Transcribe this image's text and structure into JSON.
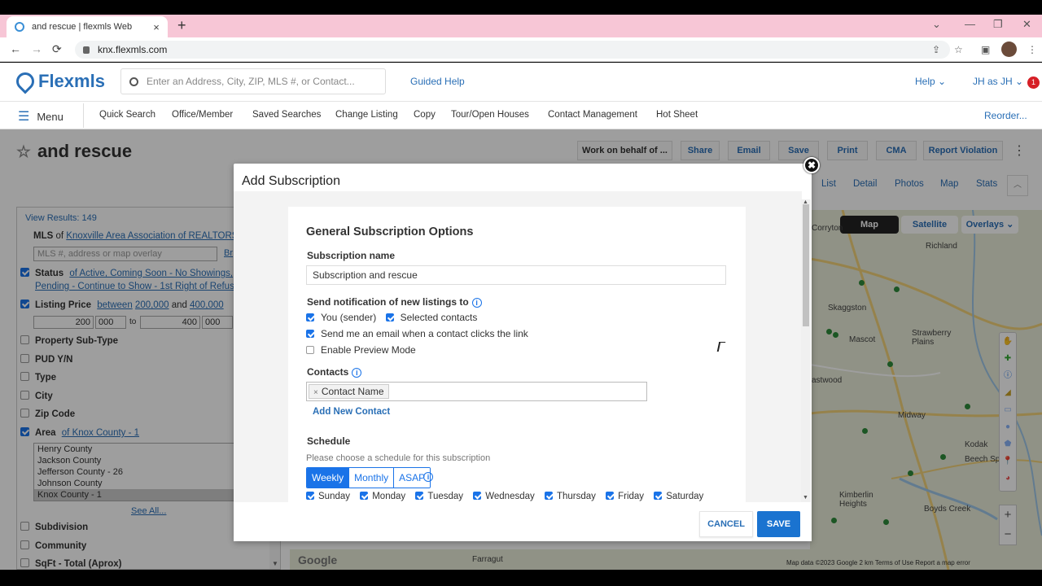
{
  "browser": {
    "tab_title": "and rescue | flexmls Web",
    "tab_close": "×",
    "new_tab": "+",
    "url": "knx.flexmls.com",
    "back": "←",
    "forward": "→",
    "reload": "⟳",
    "minimize": "—",
    "maximize": "❐",
    "close": "✕",
    "tab_menu": "⌄"
  },
  "app_header": {
    "logo_text": "Flexmls",
    "search_placeholder": "Enter an Address, City, ZIP, MLS #, or Contact...",
    "guided_help": "Guided Help",
    "help": "Help ⌄",
    "user": "JH as JH ⌄",
    "notification_count": "1"
  },
  "menu": {
    "label": "Menu",
    "items": [
      "Quick Search",
      "Office/Member",
      "Saved Searches",
      "Change Listing",
      "Copy",
      "Tour/Open Houses",
      "Contact Management",
      "Hot Sheet"
    ],
    "reorder": "Reorder..."
  },
  "page": {
    "title": "and rescue",
    "toolbar": [
      "Work on behalf of ...",
      "Share",
      "Email",
      "Save",
      "Print",
      "CMA",
      "Report Violation"
    ],
    "view_tabs": [
      "List",
      "Detail",
      "Photos",
      "Map",
      "Stats"
    ]
  },
  "filters": {
    "view_results": "View Results: 149",
    "mls_label": "MLS",
    "mls_of": "of",
    "mls_value": "Knoxville Area Association of REALTORS",
    "mls_placeholder": "MLS #, address or map overlay",
    "mls_browse": "Br",
    "status_label": "Status",
    "status_value_1": "of Active, Coming Soon - No Showings,",
    "status_value_2": "Pending - Continue to Show - 1st Right of Refus",
    "price_label": "Listing Price",
    "price_between": "between",
    "price_low": "200,000",
    "price_and": "and",
    "price_high": "400,000",
    "price_in_1": "200",
    "price_in_2": "000",
    "price_to": "to",
    "price_in_3": "400",
    "price_in_4": "000",
    "unchecked_1": [
      "Property Sub-Type",
      "PUD Y/N",
      "Type",
      "City",
      "Zip Code"
    ],
    "area_label": "Area",
    "area_value": "of Knox County - 1",
    "area_options": [
      "Henry County",
      "Jackson County",
      "Jefferson County - 26",
      "Johnson County",
      "Knox County - 1"
    ],
    "see_all": "See All...",
    "unchecked_2": [
      "Subdivision",
      "Community",
      "SqFt - Total (Aprox)"
    ]
  },
  "map": {
    "map_btn": "Map",
    "satellite_btn": "Satellite",
    "overlays_btn": "Overlays ⌄",
    "places": [
      "Corryton",
      "Richland",
      "Skaggston",
      "Mascot",
      "Strawberry Plains",
      "astwood",
      "Midway",
      "Kodak",
      "Beech Sp",
      "Kimberlin Heights",
      "Boyds Creek",
      "Farragut"
    ],
    "attribution": "Map data ©2023 Google   2 km      Terms of Use   Report a map error",
    "google": "Google"
  },
  "modal": {
    "title": "Add Subscription",
    "close": "✖",
    "section_title": "General Subscription Options",
    "subscription_name_label": "Subscription name",
    "subscription_name_value": "Subscription and rescue",
    "notify_label": "Send notification of new listings to",
    "opt_you": "You (sender)",
    "opt_selected": "Selected contacts",
    "opt_email_click": "Send me an email when a contact clicks the link",
    "opt_preview": "Enable Preview Mode",
    "contacts_label": "Contacts",
    "contact_chip": "Contact Name",
    "add_contact": "Add New Contact",
    "schedule_label": "Schedule",
    "schedule_hint": "Please choose a schedule for this subscription",
    "schedule_options": [
      "Weekly",
      "Monthly",
      "ASAP"
    ],
    "days": [
      "Sunday",
      "Monday",
      "Tuesday",
      "Wednesday",
      "Thursday",
      "Friday",
      "Saturday"
    ],
    "cancel": "CANCEL",
    "save": "SAVE"
  }
}
